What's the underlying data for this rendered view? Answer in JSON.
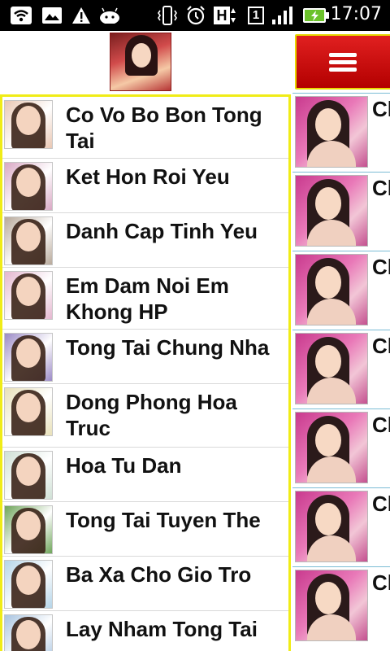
{
  "status_bar": {
    "time": "17:07",
    "icons": [
      "wifi-icon",
      "image-icon",
      "warning-icon",
      "android-icon",
      "vibrate-icon",
      "alarm-icon",
      "h-network-icon",
      "sim-1-icon",
      "signal-icon",
      "battery-charging-icon"
    ],
    "network_letter": "H",
    "sim_number": "1"
  },
  "drawer": {
    "items": [
      {
        "label": "Co Vo Bo Bon Tong Tai",
        "thumb_color": "#e9c7b3"
      },
      {
        "label": "Ket Hon Roi Yeu",
        "thumb_color": "#d9a8c4"
      },
      {
        "label": "Danh Cap Tinh Yeu",
        "thumb_color": "#b8a99a"
      },
      {
        "label": "Em Dam Noi Em Khong HP",
        "thumb_color": "#e4b6cf"
      },
      {
        "label": "Tong Tai Chung Nha",
        "thumb_color": "#9b8ac6"
      },
      {
        "label": "Dong Phong Hoa Truc",
        "thumb_color": "#e8e0b8"
      },
      {
        "label": "Hoa Tu Dan",
        "thumb_color": "#cfe0d5"
      },
      {
        "label": "Tong Tai Tuyen The",
        "thumb_color": "#6fa55a"
      },
      {
        "label": "Ba Xa Cho Gio Tro",
        "thumb_color": "#b4d4e8"
      },
      {
        "label": "Lay Nham Tong Tai",
        "thumb_color": "#a9c4e0"
      }
    ]
  },
  "main": {
    "rows": [
      {
        "title": "Ch"
      },
      {
        "title": "Ch"
      },
      {
        "title": "Ch"
      },
      {
        "title": "Ch"
      },
      {
        "title": "Ch"
      },
      {
        "title": "Ch"
      },
      {
        "title": "Ch"
      }
    ]
  },
  "colors": {
    "drawer_border": "#f0ec17",
    "menu_button": "#cc0000",
    "row_divider": "#7bbcd5"
  }
}
